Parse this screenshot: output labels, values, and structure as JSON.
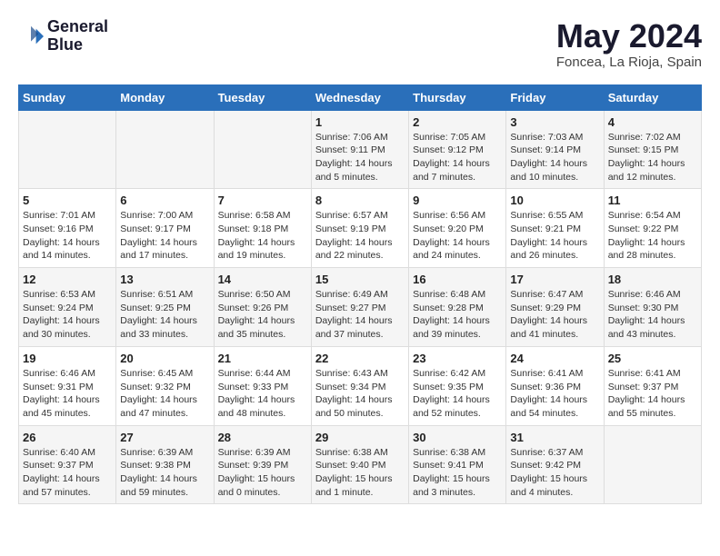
{
  "logo": {
    "line1": "General",
    "line2": "Blue"
  },
  "title": "May 2024",
  "location": "Foncea, La Rioja, Spain",
  "days_of_week": [
    "Sunday",
    "Monday",
    "Tuesday",
    "Wednesday",
    "Thursday",
    "Friday",
    "Saturday"
  ],
  "weeks": [
    [
      {
        "day": "",
        "content": ""
      },
      {
        "day": "",
        "content": ""
      },
      {
        "day": "",
        "content": ""
      },
      {
        "day": "1",
        "content": "Sunrise: 7:06 AM\nSunset: 9:11 PM\nDaylight: 14 hours\nand 5 minutes."
      },
      {
        "day": "2",
        "content": "Sunrise: 7:05 AM\nSunset: 9:12 PM\nDaylight: 14 hours\nand 7 minutes."
      },
      {
        "day": "3",
        "content": "Sunrise: 7:03 AM\nSunset: 9:14 PM\nDaylight: 14 hours\nand 10 minutes."
      },
      {
        "day": "4",
        "content": "Sunrise: 7:02 AM\nSunset: 9:15 PM\nDaylight: 14 hours\nand 12 minutes."
      }
    ],
    [
      {
        "day": "5",
        "content": "Sunrise: 7:01 AM\nSunset: 9:16 PM\nDaylight: 14 hours\nand 14 minutes."
      },
      {
        "day": "6",
        "content": "Sunrise: 7:00 AM\nSunset: 9:17 PM\nDaylight: 14 hours\nand 17 minutes."
      },
      {
        "day": "7",
        "content": "Sunrise: 6:58 AM\nSunset: 9:18 PM\nDaylight: 14 hours\nand 19 minutes."
      },
      {
        "day": "8",
        "content": "Sunrise: 6:57 AM\nSunset: 9:19 PM\nDaylight: 14 hours\nand 22 minutes."
      },
      {
        "day": "9",
        "content": "Sunrise: 6:56 AM\nSunset: 9:20 PM\nDaylight: 14 hours\nand 24 minutes."
      },
      {
        "day": "10",
        "content": "Sunrise: 6:55 AM\nSunset: 9:21 PM\nDaylight: 14 hours\nand 26 minutes."
      },
      {
        "day": "11",
        "content": "Sunrise: 6:54 AM\nSunset: 9:22 PM\nDaylight: 14 hours\nand 28 minutes."
      }
    ],
    [
      {
        "day": "12",
        "content": "Sunrise: 6:53 AM\nSunset: 9:24 PM\nDaylight: 14 hours\nand 30 minutes."
      },
      {
        "day": "13",
        "content": "Sunrise: 6:51 AM\nSunset: 9:25 PM\nDaylight: 14 hours\nand 33 minutes."
      },
      {
        "day": "14",
        "content": "Sunrise: 6:50 AM\nSunset: 9:26 PM\nDaylight: 14 hours\nand 35 minutes."
      },
      {
        "day": "15",
        "content": "Sunrise: 6:49 AM\nSunset: 9:27 PM\nDaylight: 14 hours\nand 37 minutes."
      },
      {
        "day": "16",
        "content": "Sunrise: 6:48 AM\nSunset: 9:28 PM\nDaylight: 14 hours\nand 39 minutes."
      },
      {
        "day": "17",
        "content": "Sunrise: 6:47 AM\nSunset: 9:29 PM\nDaylight: 14 hours\nand 41 minutes."
      },
      {
        "day": "18",
        "content": "Sunrise: 6:46 AM\nSunset: 9:30 PM\nDaylight: 14 hours\nand 43 minutes."
      }
    ],
    [
      {
        "day": "19",
        "content": "Sunrise: 6:46 AM\nSunset: 9:31 PM\nDaylight: 14 hours\nand 45 minutes."
      },
      {
        "day": "20",
        "content": "Sunrise: 6:45 AM\nSunset: 9:32 PM\nDaylight: 14 hours\nand 47 minutes."
      },
      {
        "day": "21",
        "content": "Sunrise: 6:44 AM\nSunset: 9:33 PM\nDaylight: 14 hours\nand 48 minutes."
      },
      {
        "day": "22",
        "content": "Sunrise: 6:43 AM\nSunset: 9:34 PM\nDaylight: 14 hours\nand 50 minutes."
      },
      {
        "day": "23",
        "content": "Sunrise: 6:42 AM\nSunset: 9:35 PM\nDaylight: 14 hours\nand 52 minutes."
      },
      {
        "day": "24",
        "content": "Sunrise: 6:41 AM\nSunset: 9:36 PM\nDaylight: 14 hours\nand 54 minutes."
      },
      {
        "day": "25",
        "content": "Sunrise: 6:41 AM\nSunset: 9:37 PM\nDaylight: 14 hours\nand 55 minutes."
      }
    ],
    [
      {
        "day": "26",
        "content": "Sunrise: 6:40 AM\nSunset: 9:37 PM\nDaylight: 14 hours\nand 57 minutes."
      },
      {
        "day": "27",
        "content": "Sunrise: 6:39 AM\nSunset: 9:38 PM\nDaylight: 14 hours\nand 59 minutes."
      },
      {
        "day": "28",
        "content": "Sunrise: 6:39 AM\nSunset: 9:39 PM\nDaylight: 15 hours\nand 0 minutes."
      },
      {
        "day": "29",
        "content": "Sunrise: 6:38 AM\nSunset: 9:40 PM\nDaylight: 15 hours\nand 1 minute."
      },
      {
        "day": "30",
        "content": "Sunrise: 6:38 AM\nSunset: 9:41 PM\nDaylight: 15 hours\nand 3 minutes."
      },
      {
        "day": "31",
        "content": "Sunrise: 6:37 AM\nSunset: 9:42 PM\nDaylight: 15 hours\nand 4 minutes."
      },
      {
        "day": "",
        "content": ""
      }
    ]
  ]
}
